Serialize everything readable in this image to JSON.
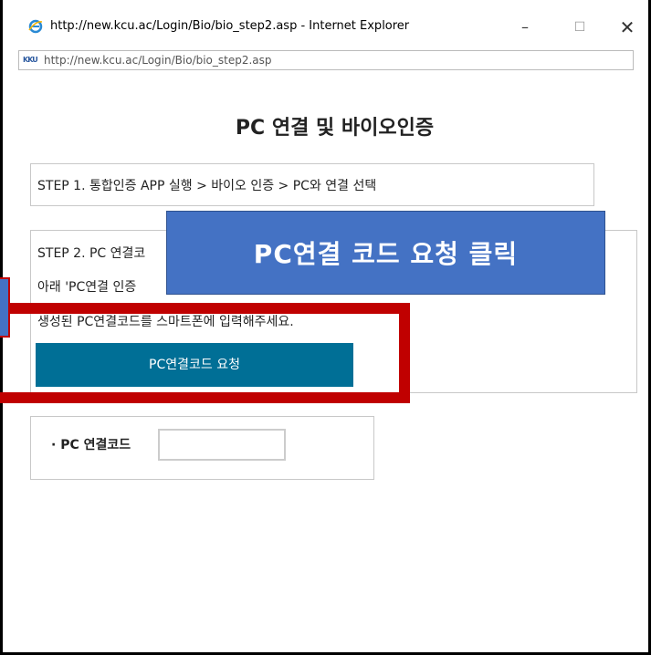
{
  "window": {
    "title": "http://new.kcu.ac/Login/Bio/bio_step2.asp - Internet Explorer",
    "minimize_icon": "–",
    "maximize_icon": "☐",
    "close_icon": "✕"
  },
  "address": {
    "site_icon": "KKU",
    "url": "http://new.kcu.ac/Login/Bio/bio_step2.asp"
  },
  "page": {
    "title": "PC 연결 및 바이오인증",
    "step1": "STEP 1. 통합인증 APP 실행 > 바이오 인증 > PC와 연결 선택",
    "step2_line1": "STEP 2. PC 연결코",
    "step2_line2": "아래 'PC연결 인증",
    "step2_line3": "생성된 PC연결코드를 스마트폰에 입력해주세요.",
    "request_button": "PC연결코드 요청",
    "code_label": "· PC 연결코드",
    "code_input_value": ""
  },
  "annotation": {
    "callout_text": "PC연결 코드 요청 클릭",
    "callout_color": "#4472c4",
    "highlight_color": "#c00000"
  },
  "colors": {
    "button_bg": "#006f96"
  }
}
